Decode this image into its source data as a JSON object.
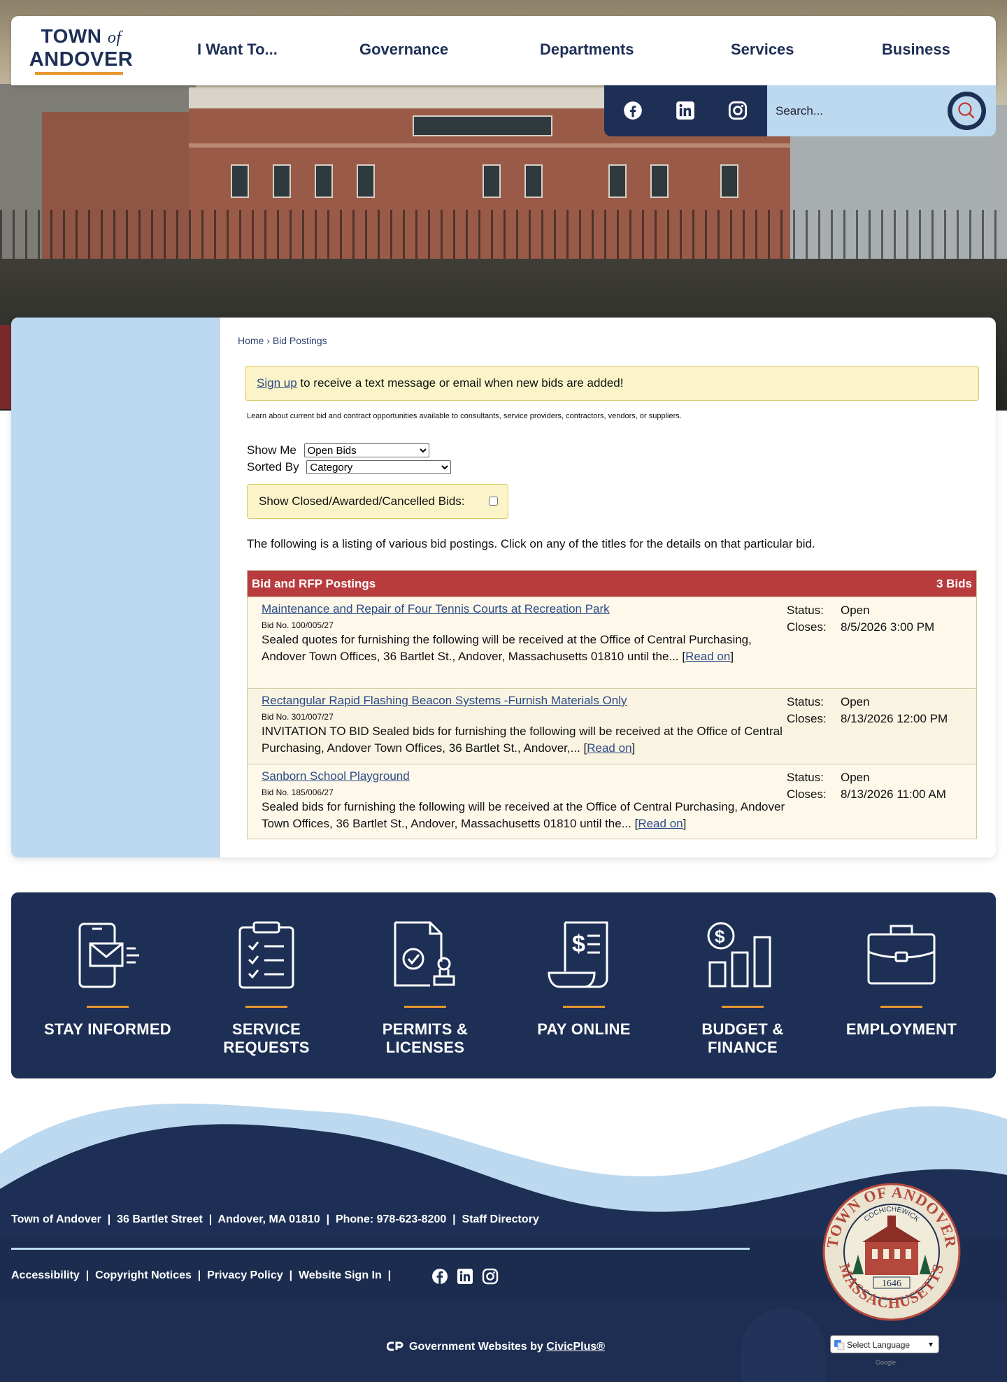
{
  "header": {
    "logo_line1": "TOWN",
    "logo_of": "of",
    "logo_line2": "ANDOVER",
    "nav": [
      "I Want To...",
      "Governance",
      "Departments",
      "Services",
      "Business"
    ],
    "search_placeholder": "Search..."
  },
  "breadcrumb": {
    "home": "Home",
    "sep": "›",
    "current": "Bid Postings"
  },
  "alert": {
    "link": "Sign up",
    "text": " to receive a text message or email when new bids are added!"
  },
  "intro": "Learn about current bid and contract opportunities available to consultants, service providers, contractors, vendors, or suppliers.",
  "filters": {
    "show_me_label": "Show Me",
    "show_me_value": "Open Bids",
    "sorted_by_label": "Sorted By",
    "sorted_by_value": "Category",
    "closed_label": "Show Closed/Awarded/Cancelled Bids:"
  },
  "lead": "The following is a listing of various bid postings. Click on any of the titles for the details on that particular bid.",
  "table": {
    "title": "Bid and RFP Postings",
    "count": "3 Bids",
    "status_label": "Status:",
    "closes_label": "Closes:",
    "read_on": "Read on",
    "rows": [
      {
        "title": "Maintenance and Repair of Four Tennis Courts at Recreation Park",
        "bid_no": "Bid No. 100/005/27",
        "desc": "Sealed quotes for furnishing the following will be received at the Office of Central Purchasing, Andover Town Offices, 36 Bartlet St., Andover, Massachusetts 01810 until the...",
        "status": "Open",
        "closes": "8/5/2026 3:00 PM"
      },
      {
        "title": "Rectangular Rapid Flashing Beacon Systems -Furnish Materials Only",
        "bid_no": "Bid No. 301/007/27",
        "desc": "INVITATION TO BID Sealed bids for furnishing the following will be received at the Office of Central Purchasing, Andover Town Offices, 36 Bartlet St., Andover,...",
        "status": "Open",
        "closes": "8/13/2026 12:00 PM"
      },
      {
        "title": "Sanborn School Playground",
        "bid_no": "Bid No. 185/006/27",
        "desc": "Sealed bids for furnishing the following will be received at the Office of Central Purchasing, Andover Town Offices, 36 Bartlet St., Andover, Massachusetts 01810 until the...",
        "status": "Open",
        "closes": "8/13/2026 11:00 AM"
      }
    ]
  },
  "quick_links": [
    {
      "line1": "STAY INFORMED",
      "line2": "",
      "icon": "phone-mail-icon"
    },
    {
      "line1": "SERVICE",
      "line2": "REQUESTS",
      "icon": "checklist-icon"
    },
    {
      "line1": "PERMITS &",
      "line2": "LICENSES",
      "icon": "document-stamp-icon"
    },
    {
      "line1": "PAY ONLINE",
      "line2": "",
      "icon": "bill-hand-icon"
    },
    {
      "line1": "BUDGET &",
      "line2": "FINANCE",
      "icon": "bar-chart-dollar-icon"
    },
    {
      "line1": "EMPLOYMENT",
      "line2": "",
      "icon": "briefcase-icon"
    }
  ],
  "footer": {
    "name": "Town of Andover",
    "address": "36 Bartlet Street",
    "city": "Andover, MA 01810",
    "phone": "Phone: 978-623-8200",
    "staff": "Staff Directory",
    "links": [
      "Accessibility",
      "Copyright Notices",
      "Privacy Policy",
      "Website Sign In"
    ],
    "civic_prefix": "Government Websites by ",
    "civic_link": "CivicPlus®",
    "language": "Select Language",
    "google": "Google",
    "seal_top": "TOWN OF ANDOVER",
    "seal_inner": "COCHICHEWICK",
    "seal_bottom": "MASSACHUSETTS",
    "seal_year": "1646"
  },
  "colors": {
    "navy": "#1d2f55",
    "light_blue": "#bcd9ef",
    "accent_orange": "#e8962f",
    "table_header_red": "#b83b3e",
    "alert_yellow": "#fbf4c9"
  }
}
